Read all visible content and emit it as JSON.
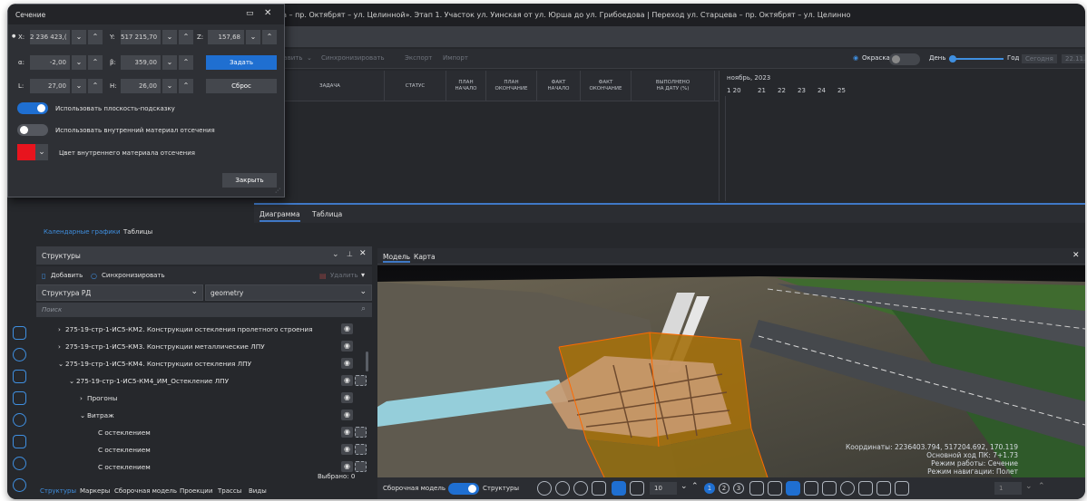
{
  "window": {
    "title": "цева – пр. Октябрят – ул. Целинной». Этап 1. Участок ул. Уинская от ул. Юрша до ул. Грибоедова | Переход ул. Старцева – пр. Октябрят – ул. Целинно"
  },
  "gantt_toolbar": {
    "add_label": "бавить",
    "sync_label": "Синхронизировать",
    "export_label": "Экспорт",
    "import_label": "Импорт",
    "coloring_label": "Окраска",
    "day_label": "День",
    "year_label": "Год",
    "today_label": "Сегодня",
    "date_value": "22.11.20"
  },
  "gantt_header": {
    "task": "ЗАДАЧА",
    "status": "СТАТУС",
    "plan_start": "ПЛАН\nНАЧАЛО",
    "plan_end": "ПЛАН\nОКОНЧАНИЕ",
    "fact_start": "ФАКТ\nНАЧАЛО",
    "fact_end": "ФАКТ\nОКОНЧАНИЕ",
    "done": "ВЫПОЛНЕНО\nНА ДАТУ (%)"
  },
  "calendar": {
    "month": "ноябрь, 2023",
    "days": [
      "1 20",
      "21",
      "22",
      "23",
      "24",
      "25"
    ]
  },
  "mid_tabs": {
    "diagram": "Диаграмма",
    "table": "Таблица"
  },
  "left_tabs": {
    "calendar": "Календарные графики",
    "tables": "Таблицы"
  },
  "structures": {
    "title": "Структуры",
    "add_label": "Добавить",
    "sync_label": "Синхронизировать",
    "delete_label": "Удалить",
    "combo1": "Структура РД",
    "combo2": "geometry",
    "search_placeholder": "Поиск",
    "rows": [
      {
        "label": "275-19-стр-1-ИС5-КМ2. Конструкции остекления пролетного строения",
        "arrow": "›"
      },
      {
        "label": "275-19-стр-1-ИС5-КМ3. Конструкции металлические ЛПУ",
        "arrow": "›"
      },
      {
        "label": "275-19-стр-1-ИС5-КМ4. Конструкции остекления ЛПУ",
        "arrow": "⌄"
      },
      {
        "label": "275-19-стр-1-ИС5-КМ4_ИМ_Остекление ЛПУ",
        "arrow": "⌄"
      },
      {
        "label": "Прогоны",
        "arrow": "›"
      },
      {
        "label": "Витраж",
        "arrow": "⌄"
      },
      {
        "label": "С остеклением",
        "arrow": ""
      },
      {
        "label": "С остеклением",
        "arrow": ""
      },
      {
        "label": "С остеклением",
        "arrow": ""
      }
    ],
    "selected_label": "Выбрано: 0"
  },
  "bottom_tabs": [
    "Структуры",
    "Маркеры",
    "Сборочная модель",
    "Проекции",
    "Трассы",
    "Виды"
  ],
  "view": {
    "tab_model": "Модель",
    "tab_map": "Карта",
    "assembly_label": "Сборочная модель",
    "structures_label": "Структуры",
    "zoom_value": "10",
    "pages": [
      "1",
      "2",
      "3"
    ],
    "coords": "Координаты:  2236403.794, 517204.692, 170.119",
    "main_pk": "Основной ход ПК:  7+1.73",
    "work_mode": "Режим работы: Сечение",
    "nav_mode": "Режим навигации: Полет",
    "right_value": "1"
  },
  "dialog": {
    "title": "Сечение",
    "x_label": "X:",
    "x_value": "2 236 423,(",
    "y_label": "Y:",
    "y_value": "517 215,70",
    "z_label": "Z:",
    "z_value": "157,68",
    "a_label": "α:",
    "a_value": "-2,00",
    "b_label": "β:",
    "b_value": "359,00",
    "apply_label": "Задать",
    "l_label": "L:",
    "l_value": "27,00",
    "h_label": "H:",
    "h_value": "26,00",
    "reset_label": "Сброс",
    "opt1": "Использовать плоскость-подсказку",
    "opt2": "Использовать внутренний материал отсечения",
    "color_label": "Цвет внутреннего материала отсечения",
    "color": "#e8141e",
    "close_label": "Закрыть"
  },
  "colors": {
    "accent": "#1f6fd1",
    "panel": "#26282c"
  }
}
